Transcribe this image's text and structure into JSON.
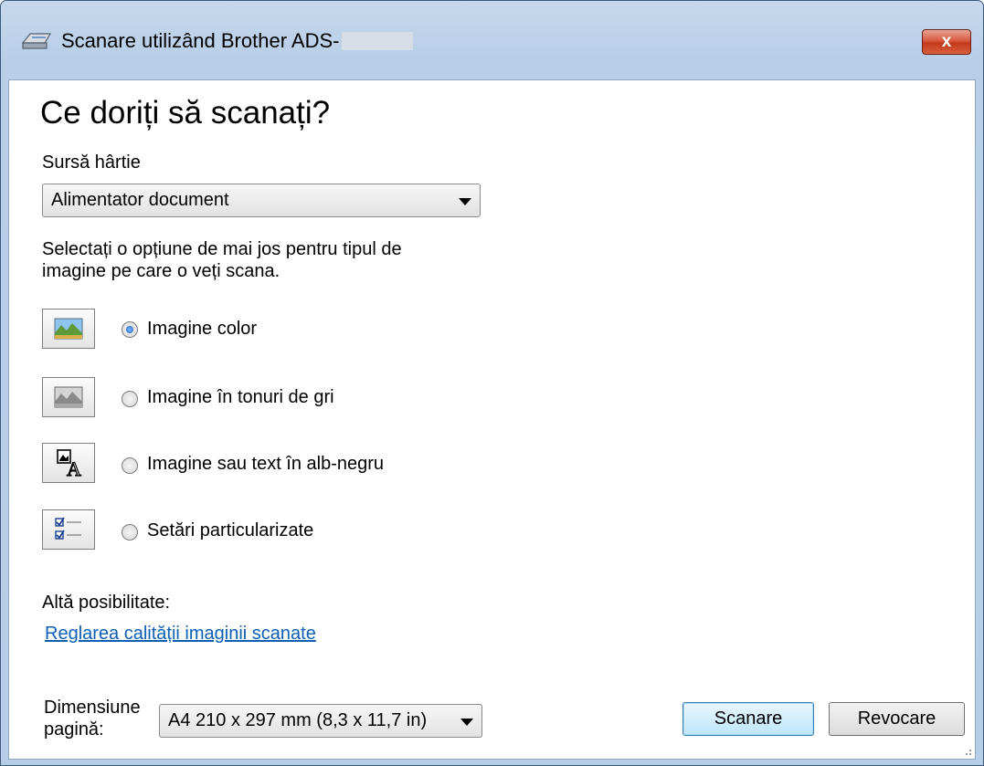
{
  "window": {
    "title": "Scanare utilizând Brother ADS-",
    "close_glyph": "x"
  },
  "heading": "Ce doriți să scanați?",
  "paper_source": {
    "label": "Sursă hârtie",
    "selected": "Alimentator document"
  },
  "instructions_line1": "Selectați o opțiune de mai jos pentru tipul de",
  "instructions_line2": "imagine pe care o veți scana.",
  "options": [
    {
      "label": "Imagine color",
      "selected": true,
      "icon": "color-picture-icon"
    },
    {
      "label": "Imagine în tonuri de gri",
      "selected": false,
      "icon": "grayscale-picture-icon"
    },
    {
      "label": "Imagine sau text în alb-negru",
      "selected": false,
      "icon": "black-white-text-icon"
    },
    {
      "label": "Setări particularizate",
      "selected": false,
      "icon": "custom-settings-icon"
    }
  ],
  "other_option": {
    "label": "Altă posibilitate:",
    "link": "Reglarea calității imaginii scanate"
  },
  "page_size": {
    "label_line1": "Dimensiune",
    "label_line2": "pagină:",
    "selected": "A4 210 x 297 mm (8,3 x 11,7 in)"
  },
  "buttons": {
    "scan": "Scanare",
    "cancel": "Revocare"
  },
  "colors": {
    "title_bar": "#b9cfe8",
    "close_button": "#c33a1c",
    "link": "#0b5fb4",
    "primary_button": "#bee6fd"
  }
}
